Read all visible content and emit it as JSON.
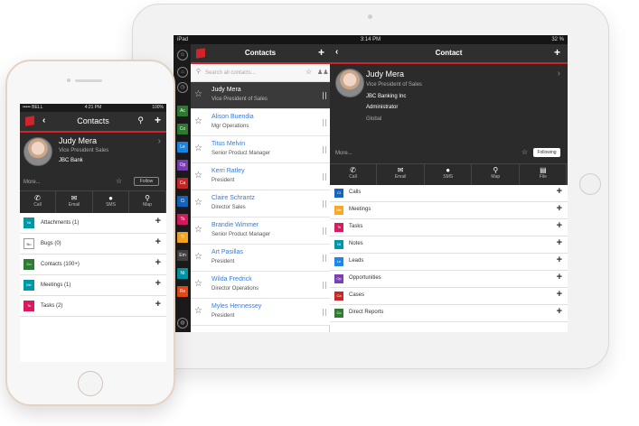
{
  "ipad": {
    "status": {
      "carrier": "iPad",
      "time": "3:14 PM",
      "battery": "32 %"
    },
    "rail": [
      {
        "code": "Ac",
        "color": "#2e7d32"
      },
      {
        "code": "Co",
        "color": "#2e7d32"
      },
      {
        "code": "Le",
        "color": "#1e88e5"
      },
      {
        "code": "Op",
        "color": "#7b3fb5"
      },
      {
        "code": "Ca",
        "color": "#c62828"
      },
      {
        "code": "Ci",
        "color": "#1565c0"
      },
      {
        "code": "Ts",
        "color": "#d81b60"
      },
      {
        "code": "Ti",
        "color": "#f9a825"
      },
      {
        "code": "Em",
        "color": "#424242"
      },
      {
        "code": "Nt",
        "color": "#0097a7"
      },
      {
        "code": "Re",
        "color": "#e64a19"
      }
    ],
    "list": {
      "title": "Contacts",
      "search_placeholder": "Search all contacts...",
      "rows": [
        {
          "name": "Judy Mera",
          "title": "Vice President of Sales",
          "selected": true
        },
        {
          "name": "Alison Buendia",
          "title": "Mgr Operations",
          "selected": false
        },
        {
          "name": "Titus Melvin",
          "title": "Senior Product Manager",
          "selected": false
        },
        {
          "name": "Kerri Ratley",
          "title": "President",
          "selected": false
        },
        {
          "name": "Claire Schrantz",
          "title": "Director Sales",
          "selected": false
        },
        {
          "name": "Brandie Wimmer",
          "title": "Senior Product Manager",
          "selected": false
        },
        {
          "name": "Art Pasillas",
          "title": "President",
          "selected": false
        },
        {
          "name": "Wilda Fredrick",
          "title": "Director Operations",
          "selected": false
        },
        {
          "name": "Myles Hennessey",
          "title": "President",
          "selected": false
        }
      ]
    },
    "detail": {
      "title": "Contact",
      "name": "Judy Mera",
      "role": "Vice President of Sales",
      "company": "JBC Banking Inc",
      "admin": "Administrator",
      "region": "Global",
      "more": "More...",
      "follow_label": "Following",
      "actions": [
        {
          "icon": "✆",
          "label": "Call"
        },
        {
          "icon": "✉",
          "label": "Email"
        },
        {
          "icon": "●",
          "label": "SMS"
        },
        {
          "icon": "⚲",
          "label": "Map"
        },
        {
          "icon": "▤",
          "label": "File"
        }
      ],
      "related": [
        {
          "code": "Cl",
          "label": "Calls",
          "color": "#1565c0"
        },
        {
          "code": "Me",
          "label": "Meetings",
          "color": "#f9a825"
        },
        {
          "code": "Ts",
          "label": "Tasks",
          "color": "#d81b60"
        },
        {
          "code": "Nt",
          "label": "Notes",
          "color": "#0097a7"
        },
        {
          "code": "Le",
          "label": "Leads",
          "color": "#1e88e5"
        },
        {
          "code": "Op",
          "label": "Opportunities",
          "color": "#7b3fb5"
        },
        {
          "code": "Ca",
          "label": "Cases",
          "color": "#c62828"
        },
        {
          "code": "Co",
          "label": "Direct Reports",
          "color": "#2e7d32"
        }
      ]
    }
  },
  "iphone": {
    "status": {
      "carrier": "••••• BELL",
      "time": "4:21 PM",
      "battery": "100%"
    },
    "header": {
      "title": "Contacts"
    },
    "contact": {
      "name": "Judy Mera",
      "role": "Vice President Sales",
      "company": "JBC Bank",
      "more": "More...",
      "follow_label": "Follow"
    },
    "actions": [
      {
        "icon": "✆",
        "label": "Call"
      },
      {
        "icon": "✉",
        "label": "Email"
      },
      {
        "icon": "●",
        "label": "SMS"
      },
      {
        "icon": "⚲",
        "label": "Map"
      }
    ],
    "related": [
      {
        "code": "Nt",
        "label": "Attachments (1)",
        "color": "#0097a7"
      },
      {
        "code": "Bu",
        "label": "Bugs (0)",
        "color": "#ffffff"
      },
      {
        "code": "Co",
        "label": "Contacts (100+)",
        "color": "#2e7d32"
      },
      {
        "code": "Me",
        "label": "Meetings (1)",
        "color": "#0097a7"
      },
      {
        "code": "Ts",
        "label": "Tasks (2)",
        "color": "#d81b60"
      }
    ]
  }
}
